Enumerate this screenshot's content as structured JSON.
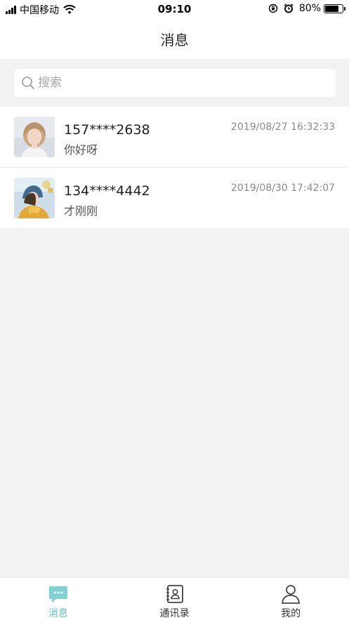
{
  "status_bar": {
    "carrier": "中国移动",
    "time": "09:10",
    "battery_text": "80%",
    "battery_level": 0.8,
    "icons": [
      "signal-icon",
      "wifi-icon",
      "rotation-lock-icon",
      "alarm-icon",
      "battery-icon"
    ]
  },
  "header": {
    "title": "消息"
  },
  "search": {
    "placeholder": "搜索",
    "value": ""
  },
  "messages": [
    {
      "name": "157****2638",
      "preview": "你好呀",
      "time": "2019/08/27 16:32:33"
    },
    {
      "name": "134****4442",
      "preview": "才刚刚",
      "time": "2019/08/30 17:42:07"
    }
  ],
  "tabs": [
    {
      "label": "消息",
      "icon": "chat-bubble-icon",
      "active": true
    },
    {
      "label": "通讯录",
      "icon": "contacts-book-icon",
      "active": false
    },
    {
      "label": "我的",
      "icon": "person-icon",
      "active": false
    }
  ],
  "colors": {
    "accent": "#5cc6c8",
    "background": "#f2f2f2",
    "text": "#222222",
    "muted": "#8a8a8a"
  }
}
